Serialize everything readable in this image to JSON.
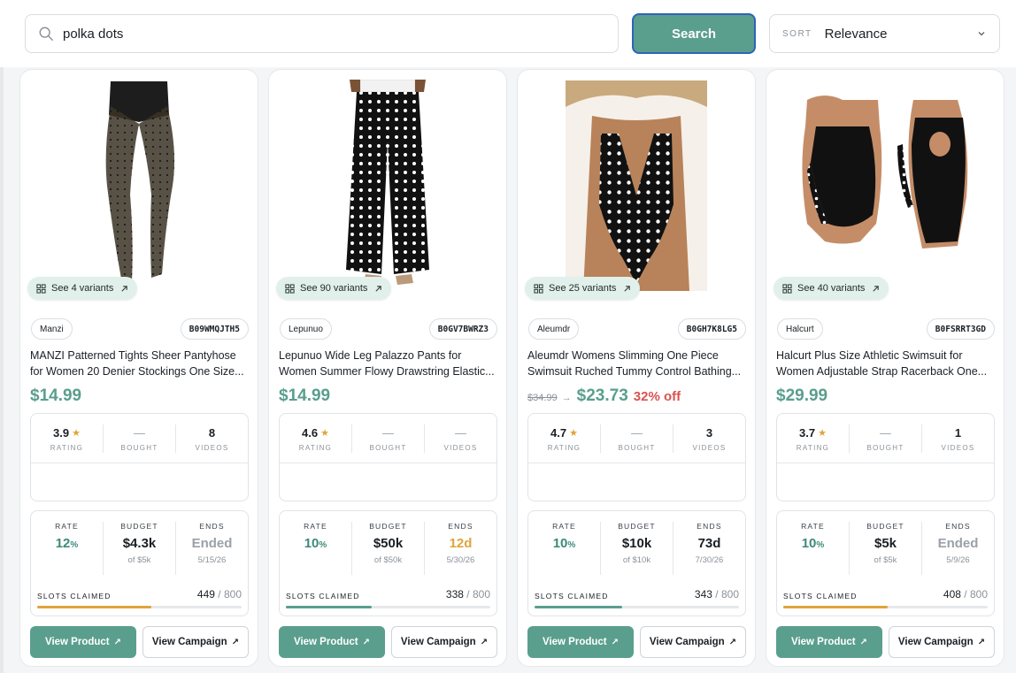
{
  "search": {
    "value": "polka dots",
    "button_label": "Search"
  },
  "sort": {
    "label": "SORT",
    "value": "Relevance"
  },
  "labels": {
    "rating": "RATING",
    "bought": "BOUGHT",
    "videos": "VIDEOS",
    "rate": "RATE",
    "budget": "BUDGET",
    "ends": "ENDS",
    "slots_claimed": "SLOTS CLAIMED",
    "view_product": "View Product",
    "view_campaign": "View Campaign"
  },
  "products": [
    {
      "variants": "See 4 variants",
      "brand": "Manzi",
      "asin": "B09WMQJTH5",
      "title": "MANZI Patterned Tights Sheer Pantyhose for Women 20 Denier Stockings One Size...",
      "price": "$14.99",
      "original_price": "",
      "discount": "",
      "rating": "3.9",
      "bought": "—",
      "videos": "8",
      "rate": "12",
      "rate_unit": "%",
      "budget": "$4.3k",
      "budget_of": "of $5k",
      "ends": "Ended",
      "ends_date": "5/15/26",
      "ends_state": "ended",
      "slots": "449",
      "slots_total": "/ 800",
      "slots_fraction": 0.56,
      "bar_color": "#e0a43a"
    },
    {
      "variants": "See 90 variants",
      "brand": "Lepunuo",
      "asin": "B0GV7BWRZ3",
      "title": "Lepunuo Wide Leg Palazzo Pants for Women Summer Flowy Drawstring Elastic...",
      "price": "$14.99",
      "original_price": "",
      "discount": "",
      "rating": "4.6",
      "bought": "—",
      "videos": "—",
      "rate": "10",
      "rate_unit": "%",
      "budget": "$50k",
      "budget_of": "of $50k",
      "ends": "12d",
      "ends_date": "5/30/26",
      "ends_state": "soon",
      "slots": "338",
      "slots_total": "/ 800",
      "slots_fraction": 0.42,
      "bar_color": "#5a9e8e"
    },
    {
      "variants": "See 25 variants",
      "brand": "Aleumdr",
      "asin": "B0GH7K8LG5",
      "title": "Aleumdr Womens Slimming One Piece Swimsuit Ruched Tummy Control Bathing...",
      "price": "$23.73",
      "original_price": "$34.99",
      "discount": "32% off",
      "rating": "4.7",
      "bought": "—",
      "videos": "3",
      "rate": "10",
      "rate_unit": "%",
      "budget": "$10k",
      "budget_of": "of $10k",
      "ends": "73d",
      "ends_date": "7/30/26",
      "ends_state": "active",
      "slots": "343",
      "slots_total": "/ 800",
      "slots_fraction": 0.43,
      "bar_color": "#5a9e8e"
    },
    {
      "variants": "See 40 variants",
      "brand": "Halcurt",
      "asin": "B0FSRRT3GD",
      "title": "Halcurt Plus Size Athletic Swimsuit for Women Adjustable Strap Racerback One...",
      "price": "$29.99",
      "original_price": "",
      "discount": "",
      "rating": "3.7",
      "bought": "—",
      "videos": "1",
      "rate": "10",
      "rate_unit": "%",
      "budget": "$5k",
      "budget_of": "of $5k",
      "ends": "Ended",
      "ends_date": "5/9/26",
      "ends_state": "ended",
      "slots": "408",
      "slots_total": "/ 800",
      "slots_fraction": 0.51,
      "bar_color": "#e0a43a"
    }
  ]
}
